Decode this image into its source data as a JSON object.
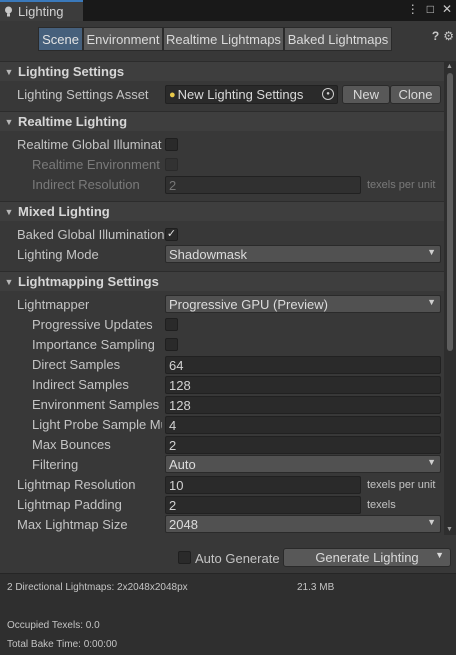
{
  "window": {
    "title": "Lighting",
    "icon": "lightbulb-icon",
    "controls": {
      "menu": "⋮",
      "maximize": "□",
      "close": "✕"
    }
  },
  "toolbar": {
    "tabs": [
      {
        "label": "Scene",
        "active": true
      },
      {
        "label": "Environment",
        "active": false
      },
      {
        "label": "Realtime Lightmaps",
        "active": false
      },
      {
        "label": "Baked Lightmaps",
        "active": false
      }
    ],
    "help_icon": "?",
    "settings_icon": "⚙"
  },
  "lighting_settings": {
    "header": "Lighting Settings",
    "asset_label": "Lighting Settings Asset",
    "asset_value": "New Lighting Settings",
    "new_label": "New",
    "clone_label": "Clone"
  },
  "realtime": {
    "header": "Realtime Lighting",
    "gi_label": "Realtime Global Illuminatio",
    "gi_checked": false,
    "env_label": "Realtime Environment L",
    "env_checked": false,
    "indirect_label": "Indirect Resolution",
    "indirect_value": "2",
    "indirect_units": "texels per unit"
  },
  "mixed": {
    "header": "Mixed Lighting",
    "baked_gi_label": "Baked Global Illumination",
    "baked_gi_checked": true,
    "baked_gi_mark": "✓",
    "mode_label": "Lighting Mode",
    "mode_value": "Shadowmask"
  },
  "lightmapping": {
    "header": "Lightmapping Settings",
    "lightmapper_label": "Lightmapper",
    "lightmapper_value": "Progressive GPU (Preview)",
    "prog_updates_label": "Progressive Updates",
    "prog_updates_checked": false,
    "importance_label": "Importance Sampling",
    "importance_checked": false,
    "direct_label": "Direct Samples",
    "direct_value": "64",
    "indirect_label": "Indirect Samples",
    "indirect_value": "128",
    "env_label": "Environment Samples",
    "env_value": "128",
    "probe_label": "Light Probe Sample Mu",
    "probe_value": "4",
    "bounces_label": "Max Bounces",
    "bounces_value": "2",
    "filtering_label": "Filtering",
    "filtering_value": "Auto",
    "res_label": "Lightmap Resolution",
    "res_value": "10",
    "res_units": "texels per unit",
    "padding_label": "Lightmap Padding",
    "padding_value": "2",
    "padding_units": "texels",
    "max_size_label": "Max Lightmap Size",
    "max_size_value": "2048"
  },
  "footer": {
    "auto_generate_label": "Auto Generate",
    "auto_generate_checked": false,
    "generate_label": "Generate Lighting",
    "stats_lightmaps": "2 Directional Lightmaps: 2x2048x2048px",
    "stats_size": "21.3 MB",
    "stats_texels": "Occupied Texels: 0.0",
    "stats_time": "Total Bake Time: 0:00:00"
  },
  "colors": {
    "accent": "#3a79bb",
    "active_tab": "#46607c",
    "bulb": "#e8c94a"
  }
}
